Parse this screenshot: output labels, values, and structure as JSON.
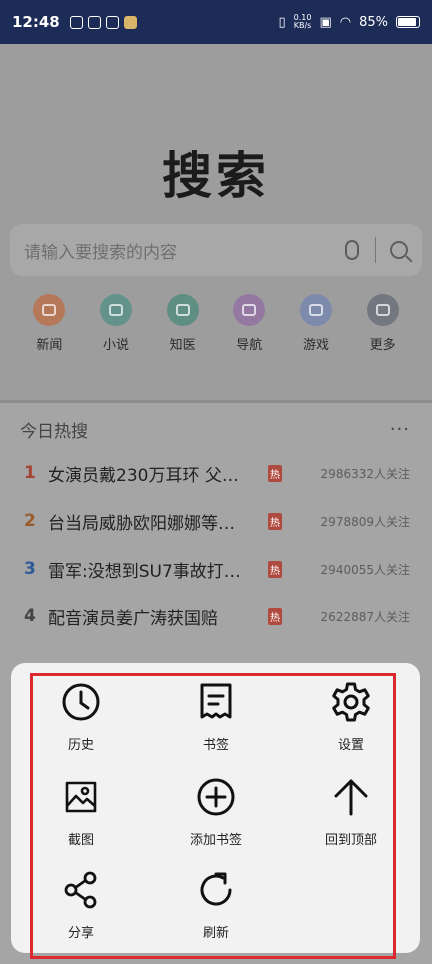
{
  "status_bar": {
    "time": "12:48",
    "net_speed_value": "0.10",
    "net_speed_unit": "KB/s",
    "battery": "85%"
  },
  "page": {
    "title": "搜索",
    "search_placeholder": "请输入要搜索的内容",
    "quick_links": [
      {
        "label": "新闻",
        "color": "#b57858"
      },
      {
        "label": "小说",
        "color": "#63928b"
      },
      {
        "label": "知医",
        "color": "#5e8f82"
      },
      {
        "label": "导航",
        "color": "#9478a1"
      },
      {
        "label": "游戏",
        "color": "#7d8aac"
      },
      {
        "label": "更多",
        "color": "#737880"
      }
    ],
    "hot_title": "今日热搜",
    "hot_more": "···",
    "hot_list": [
      {
        "rank": "1",
        "title": "女演员戴230万耳环 父…",
        "tag": "热",
        "count": "2986332人关注",
        "rank_color": "#a44333"
      },
      {
        "rank": "2",
        "title": "台当局威胁欧阳娜娜等…",
        "tag": "热",
        "count": "2978809人关注",
        "rank_color": "#9a5b2a"
      },
      {
        "rank": "3",
        "title": "雷军:没想到SU7事故打…",
        "tag": "热",
        "count": "2940055人关注",
        "rank_color": "#2e5a9a"
      },
      {
        "rank": "4",
        "title": "配音演员姜广涛获国赔",
        "tag": "热",
        "count": "2622887人关注",
        "rank_color": "#444444"
      }
    ]
  },
  "menu": {
    "items": [
      {
        "label": "历史",
        "icon": "clock-icon"
      },
      {
        "label": "书签",
        "icon": "bookmark-receipt-icon"
      },
      {
        "label": "设置",
        "icon": "gear-icon"
      },
      {
        "label": "截图",
        "icon": "image-icon"
      },
      {
        "label": "添加书签",
        "icon": "add-circle-icon"
      },
      {
        "label": "回到顶部",
        "icon": "arrow-up-icon"
      },
      {
        "label": "分享",
        "icon": "share-icon"
      },
      {
        "label": "刷新",
        "icon": "refresh-icon"
      }
    ],
    "highlight_color": "#dc2930"
  }
}
